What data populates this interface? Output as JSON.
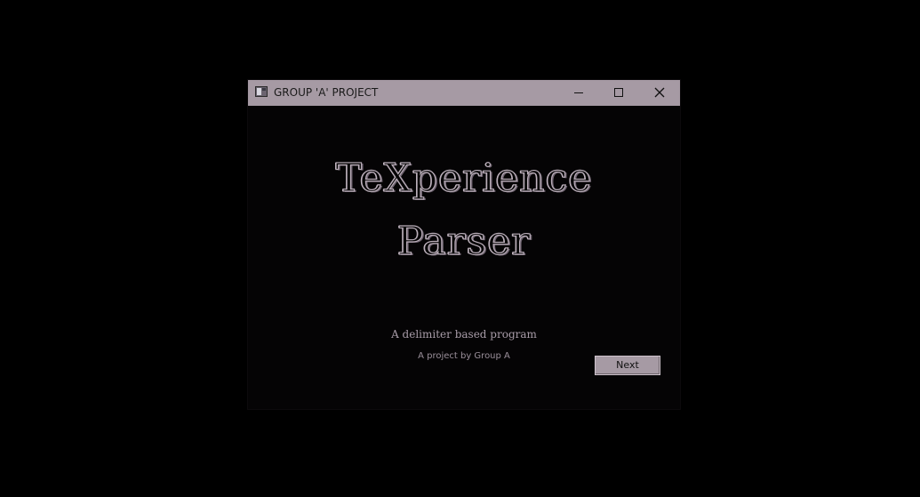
{
  "window": {
    "title": "GROUP 'A' PROJECT",
    "app_icon": "window-app-icon",
    "controls": {
      "minimize_icon": "minimize-icon",
      "maximize_icon": "maximize-icon",
      "close_icon": "close-icon"
    }
  },
  "main": {
    "heading_line1": "TeXperience",
    "heading_line2": "Parser",
    "subtitle": "A delimiter based program",
    "credit": "A project by Group A",
    "next_label": "Next"
  },
  "colors": {
    "titlebar": "#a69aa4",
    "background": "#000000",
    "accent_text": "#a89ca8"
  }
}
